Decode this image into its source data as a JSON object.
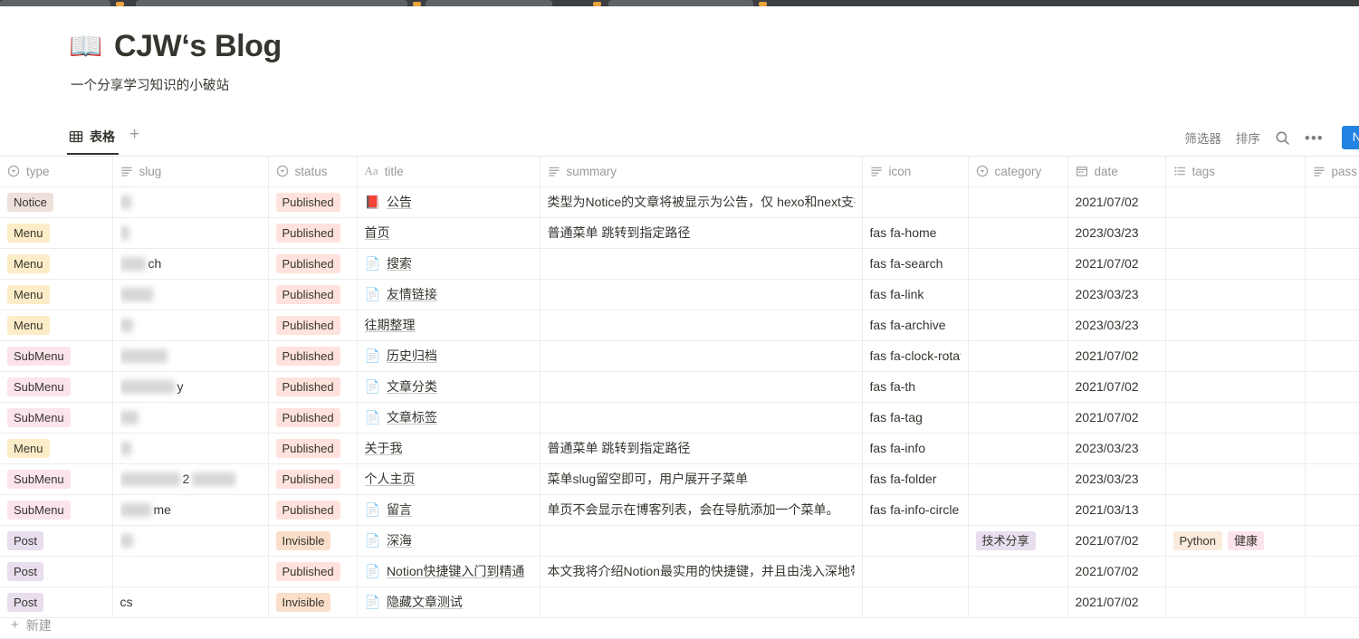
{
  "window": {
    "chrome_strip_color": "#3c4043"
  },
  "header": {
    "emoji": "📖",
    "icon_name": "person-reading-book-emoji",
    "title": "CJW‘s Blog",
    "subtitle": "一个分享学习知识的小破站"
  },
  "viewbar": {
    "tab_label": "表格",
    "tab_icon": "table-icon",
    "add_view_label": "+",
    "filter_label": "筛选器",
    "sort_label": "排序",
    "search_icon": "search-icon",
    "more_label": "•••",
    "new_button_label": "Ne"
  },
  "table": {
    "columns": [
      {
        "key": "type",
        "label": "type",
        "icon": "select-icon"
      },
      {
        "key": "slug",
        "label": "slug",
        "icon": "text-icon"
      },
      {
        "key": "status",
        "label": "status",
        "icon": "select-icon"
      },
      {
        "key": "title",
        "label": "title",
        "icon": "title-aa-icon"
      },
      {
        "key": "summary",
        "label": "summary",
        "icon": "text-icon"
      },
      {
        "key": "icon",
        "label": "icon",
        "icon": "text-icon"
      },
      {
        "key": "category",
        "label": "category",
        "icon": "select-icon"
      },
      {
        "key": "date",
        "label": "date",
        "icon": "calendar-icon"
      },
      {
        "key": "tags",
        "label": "tags",
        "icon": "multiselect-icon"
      },
      {
        "key": "password",
        "label": "pass",
        "icon": "text-icon"
      }
    ],
    "rows": [
      {
        "type": "Notice",
        "type_color": "#eee0da",
        "slug_redacted": true,
        "slug_blur_widths": [
          12
        ],
        "slug_text": "",
        "status": "Published",
        "status_color": "#ffe2dd",
        "title": "公告",
        "title_emoji": "📕",
        "summary": "类型为Notice的文章将被显示为公告，仅 hexo和next支持",
        "icon": "",
        "category": "",
        "date": "2021/07/02",
        "tags": []
      },
      {
        "type": "Menu",
        "type_color": "#fdecc8",
        "slug_redacted": true,
        "slug_blur_widths": [
          10
        ],
        "slug_text": "",
        "status": "Published",
        "status_color": "#ffe2dd",
        "title": "首页",
        "title_emoji": "",
        "summary": "普通菜单 跳转到指定路径",
        "icon": "fas fa-home",
        "category": "",
        "date": "2023/03/23",
        "tags": []
      },
      {
        "type": "Menu",
        "type_color": "#fdecc8",
        "slug_redacted": true,
        "slug_blur_widths": [
          28
        ],
        "slug_text": "ch",
        "status": "Published",
        "status_color": "#ffe2dd",
        "title": "搜索",
        "title_emoji": "📄",
        "summary": "",
        "icon": "fas fa-search",
        "category": "",
        "date": "2021/07/02",
        "tags": []
      },
      {
        "type": "Menu",
        "type_color": "#fdecc8",
        "slug_redacted": true,
        "slug_blur_widths": [
          36
        ],
        "slug_text": "",
        "status": "Published",
        "status_color": "#ffe2dd",
        "title": "友情链接",
        "title_emoji": "📄",
        "summary": "",
        "icon": "fas fa-link",
        "category": "",
        "date": "2023/03/23",
        "tags": []
      },
      {
        "type": "Menu",
        "type_color": "#fdecc8",
        "slug_redacted": true,
        "slug_blur_widths": [
          14
        ],
        "slug_text": "",
        "status": "Published",
        "status_color": "#ffe2dd",
        "title": "往期整理",
        "title_emoji": "",
        "summary": "",
        "icon": "fas fa-archive",
        "category": "",
        "date": "2023/03/23",
        "tags": []
      },
      {
        "type": "SubMenu",
        "type_color": "#fce4ec",
        "slug_redacted": true,
        "slug_blur_widths": [
          52
        ],
        "slug_text": "",
        "status": "Published",
        "status_color": "#ffe2dd",
        "title": "历史归档",
        "title_emoji": "📄",
        "summary": "",
        "icon": "fas fa-clock-rotate",
        "category": "",
        "date": "2021/07/02",
        "tags": []
      },
      {
        "type": "SubMenu",
        "type_color": "#fce4ec",
        "slug_redacted": true,
        "slug_blur_widths": [
          60
        ],
        "slug_text": "y",
        "status": "Published",
        "status_color": "#ffe2dd",
        "title": "文章分类",
        "title_emoji": "📄",
        "summary": "",
        "icon": "fas fa-th",
        "category": "",
        "date": "2021/07/02",
        "tags": []
      },
      {
        "type": "SubMenu",
        "type_color": "#fce4ec",
        "slug_redacted": true,
        "slug_blur_widths": [
          20
        ],
        "slug_text": "",
        "status": "Published",
        "status_color": "#ffe2dd",
        "title": "文章标签",
        "title_emoji": "📄",
        "summary": "",
        "icon": "fas fa-tag",
        "category": "",
        "date": "2021/07/02",
        "tags": []
      },
      {
        "type": "Menu",
        "type_color": "#fdecc8",
        "slug_redacted": true,
        "slug_blur_widths": [
          12
        ],
        "slug_text": "",
        "status": "Published",
        "status_color": "#ffe2dd",
        "title": "关于我",
        "title_emoji": "",
        "summary": "普通菜单 跳转到指定路径",
        "icon": "fas fa-info",
        "category": "",
        "date": "2023/03/23",
        "tags": []
      },
      {
        "type": "SubMenu",
        "type_color": "#fce4ec",
        "slug_redacted": true,
        "slug_blur_widths": [
          66,
          48
        ],
        "slug_text": "2",
        "status": "Published",
        "status_color": "#ffe2dd",
        "title": "个人主页",
        "title_emoji": "",
        "summary": "菜单slug留空即可，用户展开子菜单",
        "icon": "fas fa-folder",
        "category": "",
        "date": "2023/03/23",
        "tags": []
      },
      {
        "type": "SubMenu",
        "type_color": "#fce4ec",
        "slug_redacted": true,
        "slug_blur_widths": [
          34
        ],
        "slug_text": "me",
        "status": "Published",
        "status_color": "#ffe2dd",
        "title": "留言",
        "title_emoji": "📄",
        "summary": "单页不会显示在博客列表，会在导航添加一个菜单。",
        "icon": "fas fa-info-circle",
        "category": "",
        "date": "2021/03/13",
        "tags": []
      },
      {
        "type": "Post",
        "type_color": "#e8deee",
        "slug_redacted": true,
        "slug_blur_widths": [
          14
        ],
        "slug_text": "",
        "status": "Invisible",
        "status_color": "#fadec9",
        "title": "深海",
        "title_emoji": "📄",
        "summary": "",
        "icon": "",
        "category": "技术分享",
        "category_color": "#e8deee",
        "date": "2021/07/02",
        "tags": [
          {
            "label": "Python",
            "color": "#faebdd"
          },
          {
            "label": "健康",
            "color": "#fce4ec"
          }
        ]
      },
      {
        "type": "Post",
        "type_color": "#e8deee",
        "slug_redacted": false,
        "slug_blur_widths": [],
        "slug_text": "",
        "status": "Published",
        "status_color": "#ffe2dd",
        "title": "Notion快捷键入门到精通",
        "title_emoji": "📄",
        "summary": "本文我将介绍Notion最实用的快捷键，并且由浅入深地带",
        "icon": "",
        "category": "",
        "date": "2021/07/02",
        "tags": []
      },
      {
        "type": "Post",
        "type_color": "#e8deee",
        "slug_redacted": false,
        "slug_blur_widths": [],
        "slug_text": "cs",
        "status": "Invisible",
        "status_color": "#fadec9",
        "title": "隐藏文章测试",
        "title_emoji": "📄",
        "summary": "",
        "icon": "",
        "category": "",
        "date": "2021/07/02",
        "tags": []
      }
    ]
  },
  "footer": {
    "new_row_label": "新建",
    "plus": "+"
  }
}
